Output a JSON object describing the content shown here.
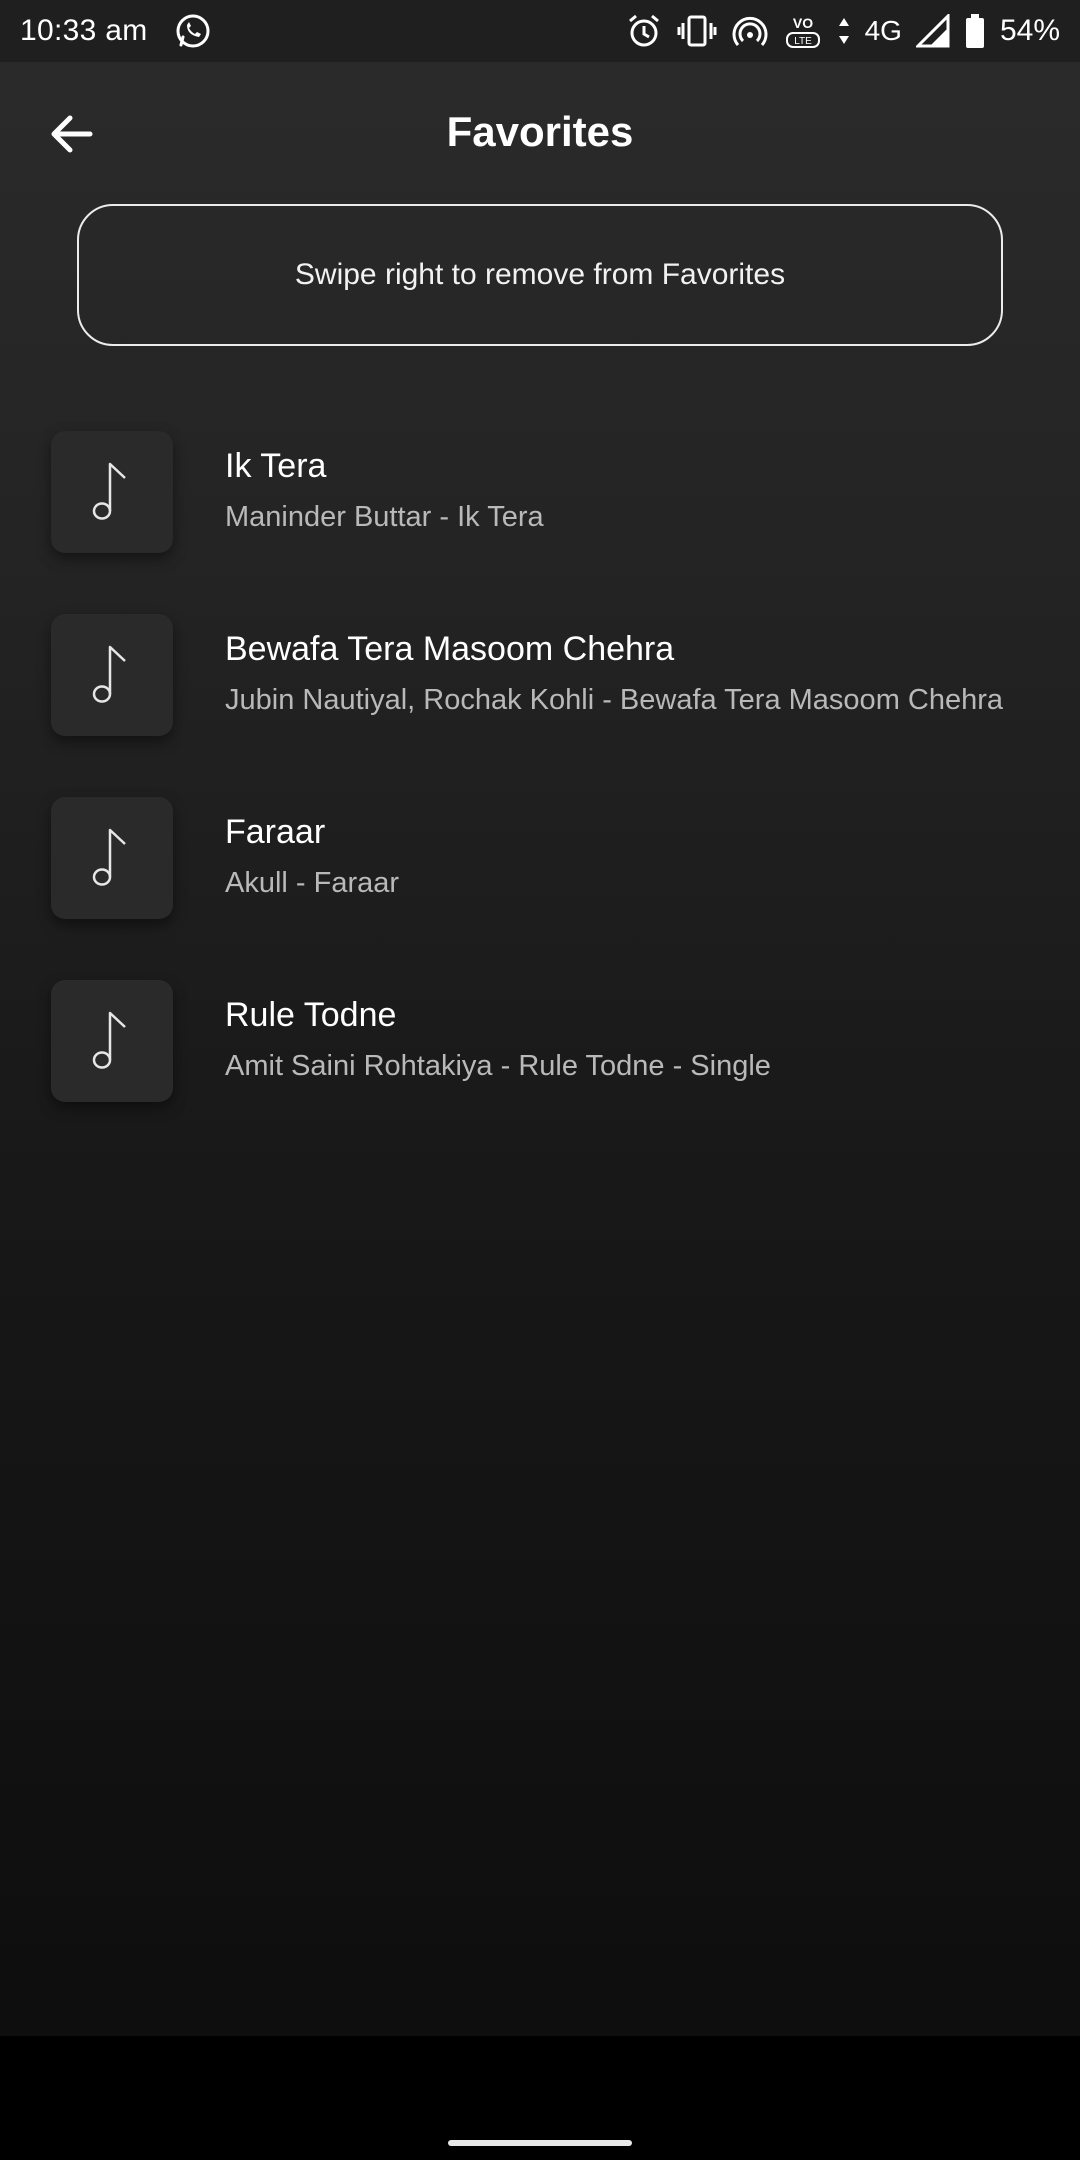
{
  "status_bar": {
    "time": "10:33 am",
    "network": "4G",
    "battery": "54%",
    "icons": [
      "whatsapp-icon",
      "alarm-icon",
      "vibrate-icon",
      "hotspot-icon",
      "volte-icon",
      "data-arrows-icon",
      "signal-icon",
      "battery-icon"
    ]
  },
  "header": {
    "title": "Favorites",
    "back_icon": "back-arrow-icon"
  },
  "hint": {
    "text": "Swipe right to remove from Favorites"
  },
  "songs": [
    {
      "title": "Ik Tera",
      "subtitle": "Maninder Buttar - Ik Tera",
      "icon": "music-note-icon"
    },
    {
      "title": "Bewafa Tera Masoom Chehra",
      "subtitle": "Jubin Nautiyal, Rochak Kohli - Bewafa Tera Masoom Chehra",
      "icon": "music-note-icon"
    },
    {
      "title": "Faraar",
      "subtitle": "Akull - Faraar",
      "icon": "music-note-icon"
    },
    {
      "title": "Rule Todne",
      "subtitle": "Amit Saini Rohtakiya - Rule Todne - Single",
      "icon": "music-note-icon"
    }
  ],
  "colors": {
    "background_top": "#2b2b2b",
    "background_bottom": "#0c0c0c",
    "thumb_bg": "#2a2a2a",
    "subtitle": "#b9b9b9"
  }
}
